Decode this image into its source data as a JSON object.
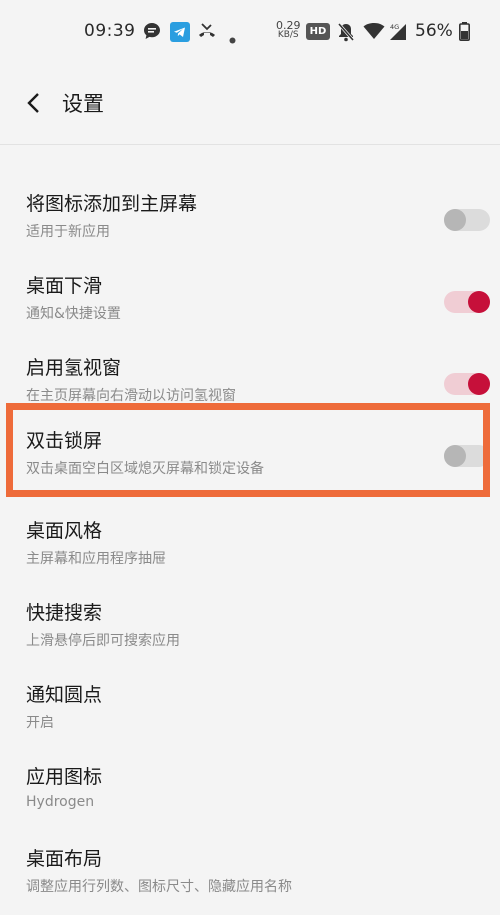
{
  "status_bar": {
    "time": "09:39",
    "net_speed_value": "0.29",
    "net_speed_unit": "KB/S",
    "hd_badge": "HD",
    "network_type": "4G",
    "battery_percent": "56%",
    "icons": [
      "chat-icon",
      "telegram-icon",
      "missed-call-icon",
      "dot-icon",
      "mute-icon",
      "wifi-icon",
      "signal-icon",
      "battery-icon"
    ]
  },
  "header": {
    "title": "设置"
  },
  "settings": {
    "items": [
      {
        "title": "将图标添加到主屏幕",
        "subtitle": "适用于新应用",
        "toggle": "off"
      },
      {
        "title": "桌面下滑",
        "subtitle": "通知&快捷设置",
        "toggle": "on"
      },
      {
        "title": "启用氢视窗",
        "subtitle": "在主页屏幕向右滑动以访问氢视窗",
        "toggle": "on"
      },
      {
        "title": "双击锁屏",
        "subtitle": "双击桌面空白区域熄灭屏幕和锁定设备",
        "toggle": "off"
      },
      {
        "title": "桌面风格",
        "subtitle": "主屏幕和应用程序抽屉"
      },
      {
        "title": "快捷搜索",
        "subtitle": "上滑悬停后即可搜索应用"
      },
      {
        "title": "通知圆点",
        "subtitle": "开启"
      },
      {
        "title": "应用图标",
        "subtitle": "Hydrogen"
      },
      {
        "title": "桌面布局",
        "subtitle": "调整应用行列数、图标尺寸、隐藏应用名称"
      }
    ]
  },
  "colors": {
    "accent": "#c6103a",
    "toggle_on_track": "#f0cdd4",
    "toggle_off_track": "#dcdcdc",
    "highlight_border": "#ee6b3a",
    "background": "#f4f4f4"
  }
}
